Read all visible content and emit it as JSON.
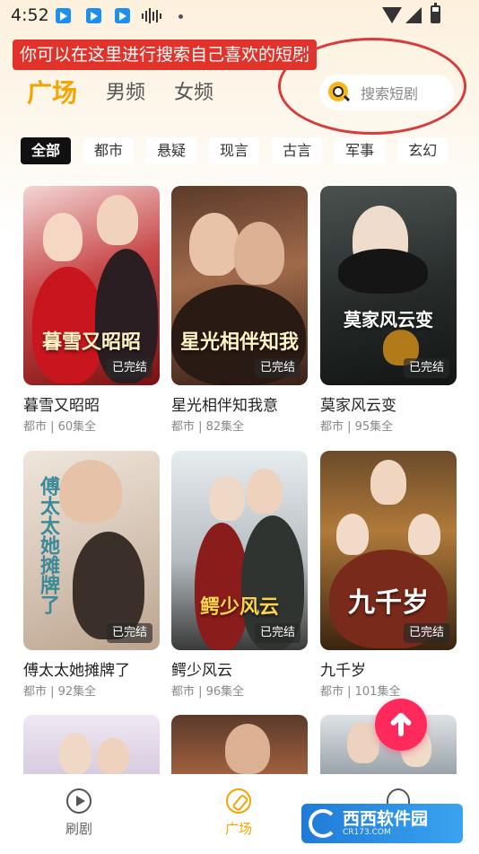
{
  "status_bar": {
    "time": "4:52"
  },
  "annotation": {
    "text": "你可以在这里进行搜索自己喜欢的短剧"
  },
  "header": {
    "tabs": [
      {
        "label": "广场",
        "active": true
      },
      {
        "label": "男频",
        "active": false
      },
      {
        "label": "女频",
        "active": false
      }
    ],
    "search": {
      "placeholder": "搜索短剧"
    }
  },
  "categories": [
    "全部",
    "都市",
    "悬疑",
    "现言",
    "古言",
    "军事",
    "玄幻"
  ],
  "dramas": [
    {
      "title": "暮雪又昭昭",
      "meta": "都市 | 60集全",
      "badge": "已完结",
      "poster_text": "暮雪又昭昭"
    },
    {
      "title": "星光相伴知我意",
      "meta": "都市 | 82集全",
      "badge": "已完结",
      "poster_text": "星光相伴知我"
    },
    {
      "title": "莫家风云变",
      "meta": "都市 | 95集全",
      "badge": "已完结",
      "poster_text": "莫家风云变"
    },
    {
      "title": "傅太太她摊牌了",
      "meta": "都市 | 92集全",
      "badge": "已完结",
      "poster_text": "傅太太她摊牌了"
    },
    {
      "title": "鳄少风云",
      "meta": "都市 | 96集全",
      "badge": "已完结",
      "poster_text": "鳄少风云"
    },
    {
      "title": "九千岁",
      "meta": "都市 | 101集全",
      "badge": "已完结",
      "poster_text": "九千岁"
    }
  ],
  "bottom_nav": [
    {
      "label": "刷剧",
      "icon": "play-circle-icon"
    },
    {
      "label": "广场",
      "icon": "compass-icon"
    },
    {
      "label": "",
      "icon": "chat-icon"
    }
  ],
  "watermark": {
    "name": "西西软件园",
    "url": "CR173.COM"
  },
  "colors": {
    "accent": "#f5a300",
    "fab": "#ff2a5c",
    "annotation": "#e2332b"
  }
}
